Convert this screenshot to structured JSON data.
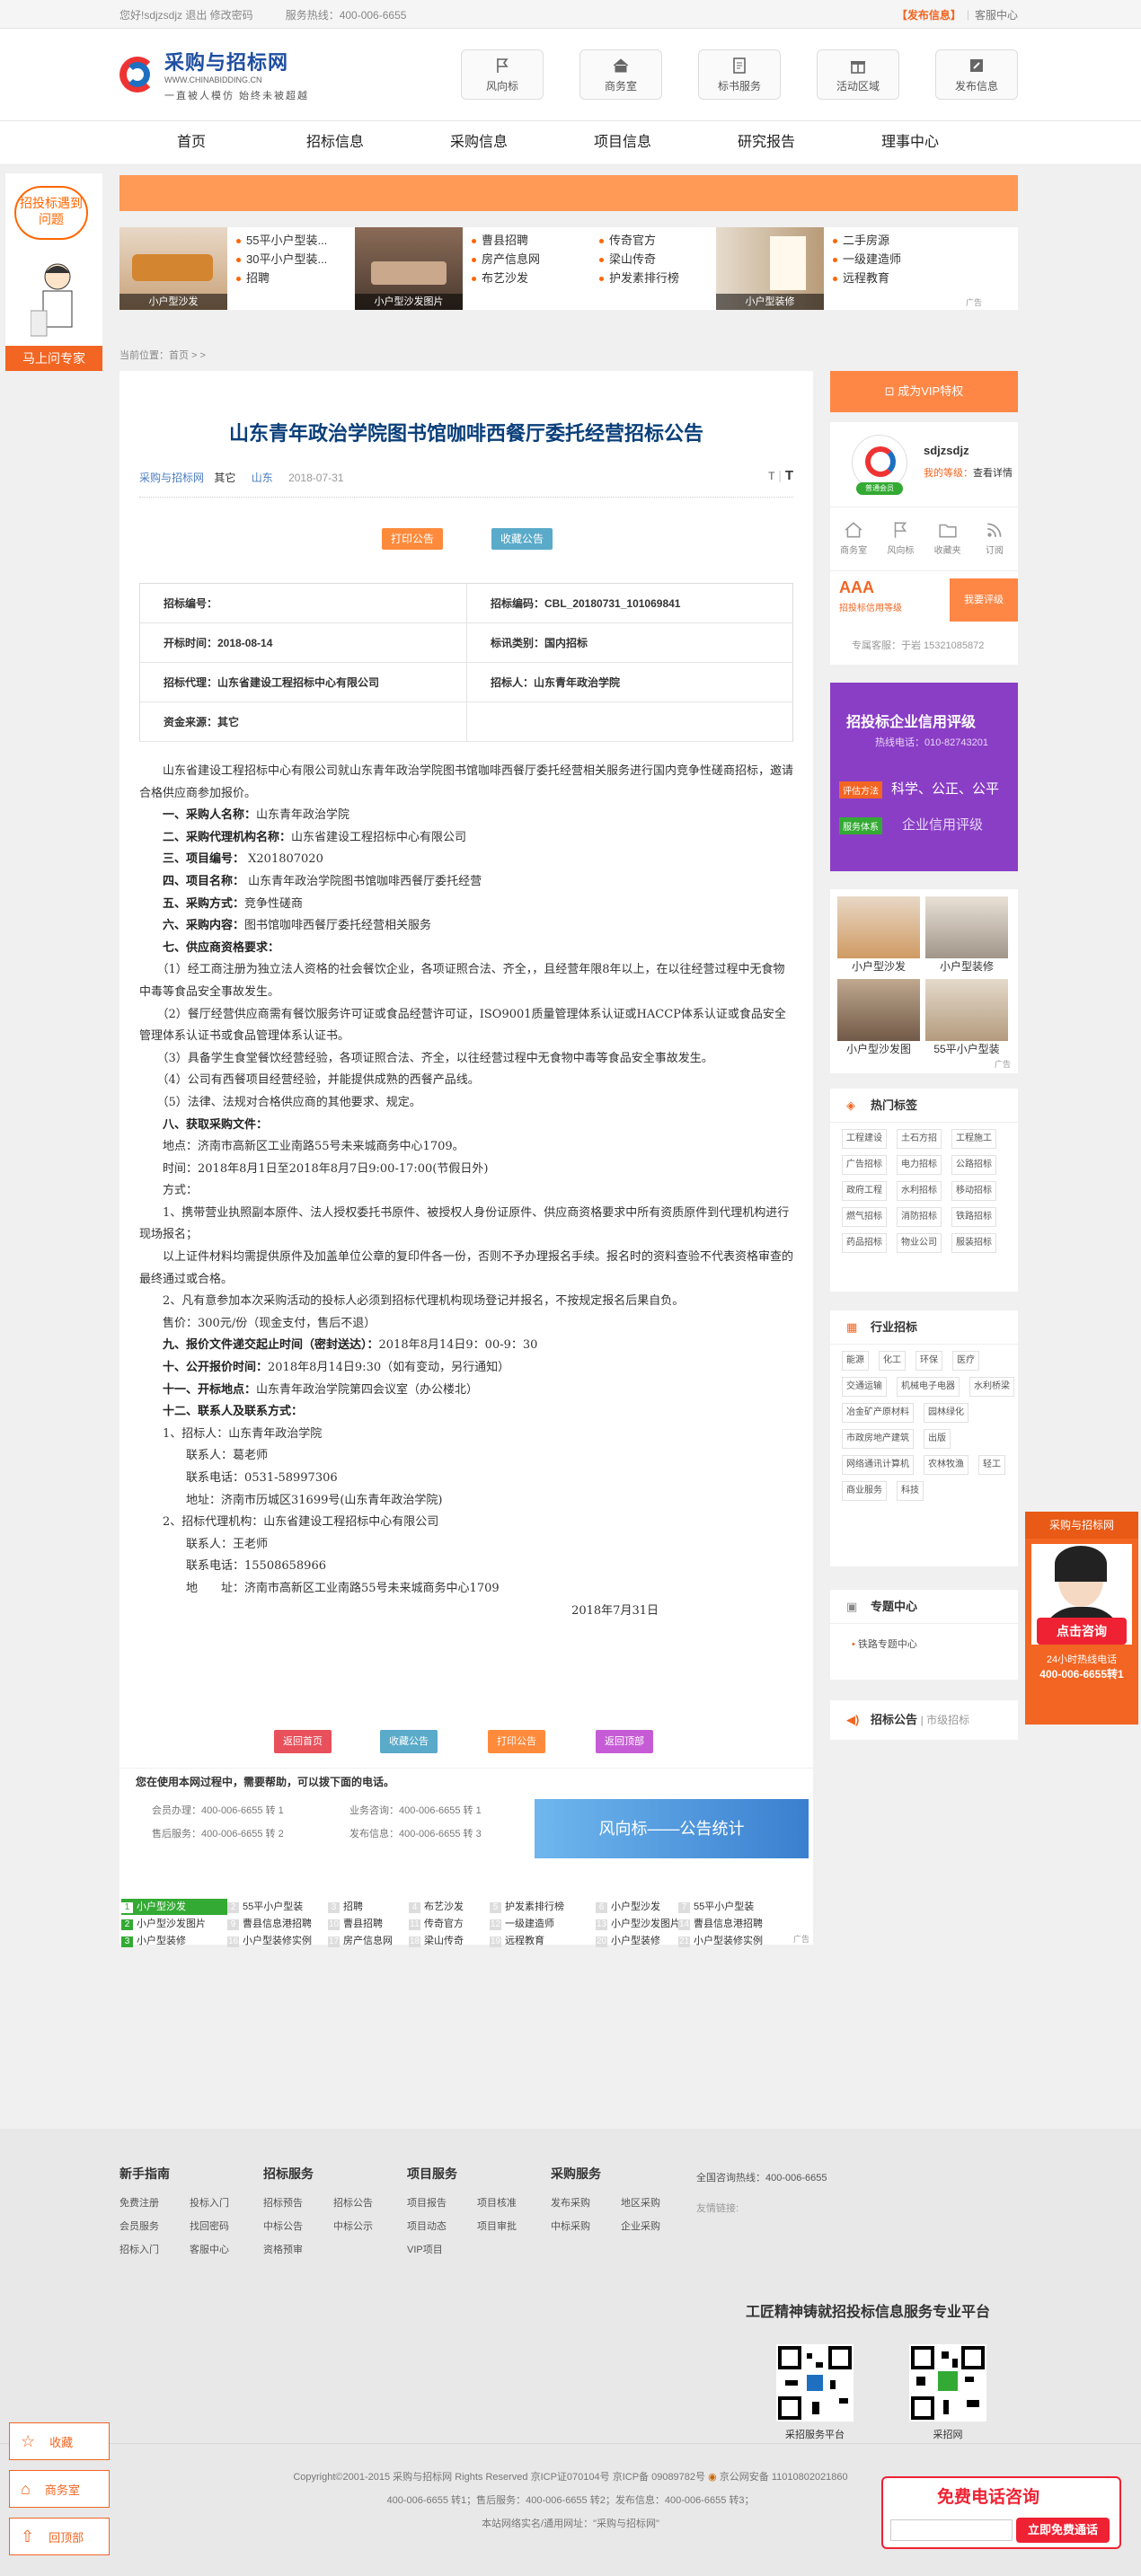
{
  "topbar": {
    "greeting": "您好!sdjzsdjz 退出 修改密码",
    "hotline": "服务热线：400-006-6655",
    "publish": "【发布信息】",
    "service_center": "客服中心"
  },
  "logo": {
    "name": "采购与招标网",
    "url": "WWW.CHINABIDDING.CN",
    "slogan": "一直被人模仿   始终未被超越"
  },
  "header_icons": [
    {
      "label": "风向标",
      "icon": "flag-icon"
    },
    {
      "label": "商务室",
      "icon": "home-icon"
    },
    {
      "label": "标书服务",
      "icon": "doc-icon"
    },
    {
      "label": "活动区域",
      "icon": "gift-icon"
    },
    {
      "label": "发布信息",
      "icon": "edit-icon"
    }
  ],
  "nav": [
    "首页",
    "招标信息",
    "采购信息",
    "项目信息",
    "研究报告",
    "理事中心"
  ],
  "left_ad": {
    "bubble": "招投标遇到问题",
    "button": "马上问专家"
  },
  "ad_row": {
    "groups": [
      {
        "caption": "小户型沙发",
        "links": [
          "55平小户型装...",
          "30平小户型装...",
          "招聘"
        ]
      },
      {
        "caption": "小户型沙发图片",
        "links": [
          "曹县招聘",
          "房产信息网",
          "布艺沙发"
        ]
      },
      {
        "caption": "",
        "links": [
          "传奇官方",
          "梁山传奇",
          "护发素排行榜"
        ]
      },
      {
        "caption": "小户型装修",
        "links": [
          "二手房源",
          "一级建造师",
          "远程教育"
        ]
      }
    ],
    "ad_mark": "广告"
  },
  "breadcrumb": "当前位置：首页 > >",
  "article": {
    "title": "山东青年政治学院图书馆咖啡西餐厅委托经营招标公告",
    "source": "采购与招标网",
    "category": "其它",
    "region": "山东",
    "date": "2018-07-31",
    "font_small": "T",
    "font_large": "T",
    "btn_print": "打印公告",
    "btn_fav": "收藏公告",
    "info": [
      [
        "招标编号：",
        "招标编码：CBL_20180731_101069841"
      ],
      [
        "开标时间：2018-08-14",
        "标讯类别：国内招标"
      ],
      [
        "招标代理：山东省建设工程招标中心有限公司",
        "招标人：山东青年政治学院"
      ],
      [
        "资金来源：其它",
        ""
      ]
    ],
    "paragraphs": [
      "　　山东省建设工程招标中心有限公司就山东青年政治学院图书馆咖啡西餐厅委托经营相关服务进行国内竞争性磋商招标，邀请合格供应商参加报价。",
      "　　一、采购人名称：山东青年政治学院",
      "　　二、采购代理机构名称：山东省建设工程招标中心有限公司",
      "　　三、项目编号：  X201807020",
      "　　四、项目名称：  山东青年政治学院图书馆咖啡西餐厅委托经营",
      "　　五、采购方式：竞争性磋商",
      "　　六、采购内容：图书馆咖啡西餐厅委托经营相关服务",
      "　　七、供应商资格要求：",
      "　　（1）经工商注册为独立法人资格的社会餐饮企业，各项证照合法、齐全，，且经营年限8年以上，在以往经营过程中无食物中毒等食品安全事故发生。",
      "　　（2）餐厅经营供应商需有餐饮服务许可证或食品经营许可证，ISO9001质量管理体系认证或HACCP体系认证或食品安全管理体系认证书或食品管理体系认证书。",
      "　　（3）具备学生食堂餐饮经营经验，各项证照合法、齐全，以往经营过程中无食物中毒等食品安全事故发生。",
      "　　（4）公司有西餐项目经营经验，并能提供成熟的西餐产品线。",
      "　　（5）法律、法规对合格供应商的其他要求、规定。",
      "　　八、获取采购文件：",
      "　　地点：济南市高新区工业南路55号未来城商务中心1709。",
      "　　时间：2018年8月1日至2018年8月7日9:00-17:00(节假日外)",
      "　　方式：",
      "　　1、携带营业执照副本原件、法人授权委托书原件、被授权人身份证原件、供应商资格要求中所有资质原件到代理机构进行现场报名；",
      "　　以上证件材料均需提供原件及加盖单位公章的复印件各一份，否则不予办理报名手续。报名时的资料查验不代表资格审查的最终通过或合格。",
      "　　2、凡有意参加本次采购活动的投标人必须到招标代理机构现场登记并报名，不按规定报名后果自负。",
      "　　售价：300元/份（现金支付，售后不退）",
      "　　九、报价文件递交起止时间（密封送达）：2018年8月14日9：00-9：30",
      "　　十、公开报价时间：2018年8月14日9:30（如有变动，另行通知）",
      "　　十一、开标地点：山东青年政治学院第四会议室（办公楼北）",
      "　　十二、联系人及联系方式：",
      "　　1、招标人：山东青年政治学院",
      "　　　　联系人：葛老师",
      "　　　　联系电话：0531-58997306",
      "　　　　地址：济南市历城区31699号(山东青年政治学院)",
      "　　2、招标代理机构：山东省建设工程招标中心有限公司",
      "　　　　联系人：王老师",
      "　　　　联系电话：15508658966",
      "　　　　地　　址：济南市高新区工业南路55号未来城商务中心1709",
      "2018年7月31日"
    ],
    "bottom_buttons": [
      "返回首页",
      "收藏公告",
      "打印公告",
      "返回顶部"
    ]
  },
  "help": {
    "heading": "您在使用本网过程中，需要帮助，可以拨下面的电话。",
    "lines": [
      "会员办理：400-006-6655 转 1",
      "业务咨询：400-006-6655 转 1",
      "售后服务：400-006-6655 转 2",
      "发布信息：400-006-6655 转 3"
    ],
    "banner": "风向标——公告统计"
  },
  "keywords": [
    [
      "1",
      "小户型沙发"
    ],
    [
      "2",
      "55平小户型装"
    ],
    [
      "3",
      "招聘"
    ],
    [
      "4",
      "布艺沙发"
    ],
    [
      "5",
      "护发素排行榜"
    ],
    [
      "6",
      "小户型沙发"
    ],
    [
      "7",
      "55平小户型装"
    ],
    [
      "2",
      "小户型沙发图片"
    ],
    [
      "9",
      "曹县信息港招聘"
    ],
    [
      "10",
      "曹县招聘"
    ],
    [
      "11",
      "传奇官方"
    ],
    [
      "12",
      "一级建造师"
    ],
    [
      "13",
      "小户型沙发图片"
    ],
    [
      "14",
      "曹县信息港招聘"
    ],
    [
      "3",
      "小户型装修"
    ],
    [
      "16",
      "小户型装修实例"
    ],
    [
      "17",
      "房产信息网"
    ],
    [
      "18",
      "梁山传奇"
    ],
    [
      "19",
      "远程教育"
    ],
    [
      "20",
      "小户型装修"
    ],
    [
      "21",
      "小户型装修实例"
    ]
  ],
  "sidebar": {
    "vip_button": "成为VIP特权",
    "user": {
      "name": "sdjzsdjz",
      "tier_label": "我的等级：",
      "detail": "查看详情",
      "badge": "普通会员"
    },
    "user_icons": [
      "商务室",
      "风向标",
      "收藏夹",
      "订阅"
    ],
    "credit": {
      "grade": "AAA",
      "label": "招投标信用等级",
      "btn": "我要评级"
    },
    "advisor": "专属客服：于岩 15321085872",
    "credit_ad": {
      "title": "招投标企业信用评级",
      "phone": "热线电话：010-82743201",
      "tag1": "评估方法",
      "text1": "科学、公正、公平",
      "tag2": "服务体系",
      "text2": "企业信用评级"
    },
    "image_ads": [
      "小户型沙发",
      "小户型装修",
      "小户型沙发图",
      "55平小户型装"
    ],
    "ad_mark": "广告",
    "hot_tags_title": "热门标签",
    "hot_tags": [
      "工程建设",
      "土石方招",
      "工程施工",
      "广告招标",
      "电力招标",
      "公路招标",
      "政府工程",
      "水利招标",
      "移动招标",
      "燃气招标",
      "消防招标",
      "铁路招标",
      "药品招标",
      "物业公司",
      "服装招标"
    ],
    "industry_title": "行业招标",
    "industry_tags": [
      "能源",
      "化工",
      "环保",
      "医疗",
      "交通运输",
      "机械电子电器",
      "水利桥梁",
      "冶金矿产原材料",
      "园林绿化",
      "市政房地产建筑",
      "出版",
      "网络通讯计算机",
      "农林牧渔",
      "轻工",
      "商业服务",
      "科技"
    ],
    "special_title": "专题中心",
    "special_item": "铁路专题中心",
    "notice_title": "招标公告",
    "notice_sub": "| 市级招标"
  },
  "float_right": {
    "title": "采购与招标网",
    "btn": "点击咨询",
    "line1": "24小时热线电话",
    "line2": "400-006-6655转1"
  },
  "footer": {
    "cols": [
      {
        "title": "新手指南",
        "items": [
          "免费注册",
          "投标入门",
          "会员服务",
          "找回密码",
          "招标入门",
          "客服中心"
        ]
      },
      {
        "title": "招标服务",
        "items": [
          "招标预告",
          "招标公告",
          "中标公告",
          "中标公示",
          "资格预审"
        ]
      },
      {
        "title": "项目服务",
        "items": [
          "项目报告",
          "项目核准",
          "项目动态",
          "项目审批",
          "VIP项目"
        ]
      },
      {
        "title": "采购服务",
        "items": [
          "发布采购",
          "地区采购",
          "中标采购",
          "企业采购"
        ]
      }
    ],
    "hotline": "全国咨询热线：400-006-6655",
    "friend_links": "友情链接:",
    "slogan": "工匠精神铸就招投标信息服务专业平台",
    "qr1": "采招服务平台",
    "qr2": "采招网",
    "copyright": "Copyright©2001-2015 采购与招标网 Rights Reserved 京ICP证070104号 京ICP备 09089782号",
    "police": "京公网安备 11010802021860",
    "phones": "400-006-6655 转1；售后服务：400-006-6655 转2；发布信息：400-006-6655 转3；",
    "site_name": "本站网络实名/通用网址：\"采购与招标网\""
  },
  "left_float": [
    "收藏",
    "商务室",
    "回顶部"
  ],
  "consult_box": {
    "title": "免费电话咨询",
    "btn": "立即免费通话"
  }
}
